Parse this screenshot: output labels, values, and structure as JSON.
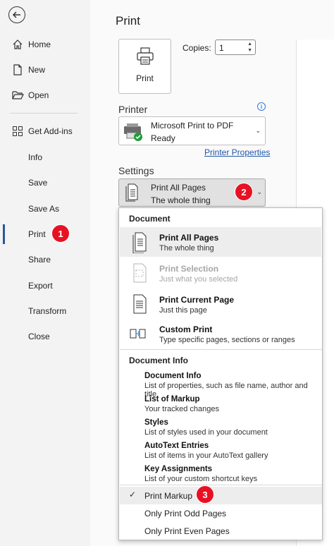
{
  "nav": {
    "items": [
      {
        "label": "Home",
        "icon": "home-icon"
      },
      {
        "label": "New",
        "icon": "new-document-icon"
      },
      {
        "label": "Open",
        "icon": "folder-open-icon"
      },
      {
        "label": "Get Add-ins",
        "icon": "add-ins-icon"
      },
      {
        "label": "Info"
      },
      {
        "label": "Save"
      },
      {
        "label": "Save As"
      },
      {
        "label": "Print"
      },
      {
        "label": "Share"
      },
      {
        "label": "Export"
      },
      {
        "label": "Transform"
      },
      {
        "label": "Close"
      }
    ],
    "active": "Print",
    "accent": "#2b579a"
  },
  "badges": [
    "1",
    "2",
    "3"
  ],
  "main": {
    "title": "Print",
    "print_button": "Print",
    "copies_label": "Copies:",
    "copies_value": "1",
    "printer_heading": "Printer",
    "info_icon": "i",
    "printer_name": "Microsoft Print to PDF",
    "printer_status": "Ready",
    "printer_properties": "Printer Properties",
    "settings_heading": "Settings",
    "settings_line1": "Print All Pages",
    "settings_line2": "The whole thing"
  },
  "dropdown": {
    "document_heading": "Document",
    "document_items": [
      {
        "title": "Print All Pages",
        "subtitle": "The whole thing",
        "icon": "all-pages-icon"
      },
      {
        "title": "Print Selection",
        "subtitle": "Just what you selected",
        "icon": "selection-icon",
        "disabled": true
      },
      {
        "title": "Print Current Page",
        "subtitle": "Just this page",
        "icon": "current-page-icon"
      },
      {
        "title": "Custom Print",
        "subtitle": "Type specific pages, sections or ranges",
        "icon": "custom-print-icon"
      }
    ],
    "document_info_heading": "Document Info",
    "info_items": [
      {
        "title": "Document Info",
        "subtitle": "List of properties, such as file name, author and title"
      },
      {
        "title": "List of Markup",
        "subtitle": "Your tracked changes"
      },
      {
        "title": "Styles",
        "subtitle": "List of styles used in your document"
      },
      {
        "title": "AutoText Entries",
        "subtitle": "List of items in your AutoText gallery"
      },
      {
        "title": "Key Assignments",
        "subtitle": "List of your custom shortcut keys"
      }
    ],
    "options": [
      {
        "label": "Print Markup",
        "checked": true
      },
      {
        "label": "Only Print Odd Pages"
      },
      {
        "label": "Only Print Even Pages"
      }
    ],
    "check_mark": "✓",
    "badge_color": "#e81123"
  }
}
